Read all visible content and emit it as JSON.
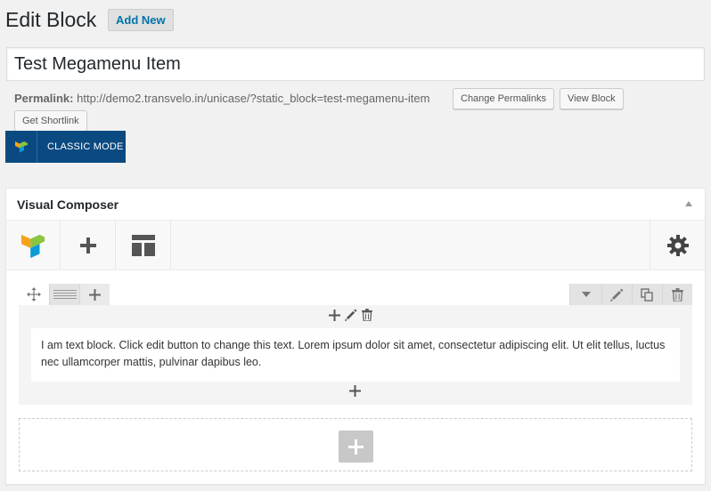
{
  "header": {
    "title": "Edit Block",
    "add_new_label": "Add New"
  },
  "post": {
    "title_value": "Test Megamenu Item",
    "permalink_label": "Permalink:",
    "permalink_url": "http://demo2.transvelo.in/unicase/?static_block=test-megamenu-item",
    "change_permalinks_label": "Change Permalinks",
    "view_block_label": "View Block",
    "get_shortlink_label": "Get Shortlink"
  },
  "classic_mode": {
    "label": "CLASSIC MODE",
    "icon": "vc-logo-icon"
  },
  "composer": {
    "title": "Visual Composer",
    "toolbar": {
      "items": [
        "vc-logo-icon",
        "plus-icon",
        "template-icon"
      ],
      "settings_icon": "gear-icon"
    },
    "row": {
      "left_controls": [
        "move-icon",
        "column-layout-icon",
        "plus-icon"
      ],
      "right_controls": [
        "chevron-down-icon",
        "pencil-icon",
        "clone-icon",
        "trash-icon"
      ],
      "element_controls": [
        "plus-icon",
        "pencil-icon",
        "trash-icon"
      ],
      "text_block": "I am text block. Click edit button to change this text. Lorem ipsum dolor sit amet, consectetur adipiscing elit. Ut elit tellus, luctus nec ullamcorper mattis, pulvinar dapibus leo."
    }
  },
  "colors": {
    "classic_bg": "#0b4a81",
    "link_blue": "#0073aa",
    "logo_orange": "#f7a21b",
    "logo_green": "#8bc53f",
    "logo_blue": "#0e9bd8"
  }
}
